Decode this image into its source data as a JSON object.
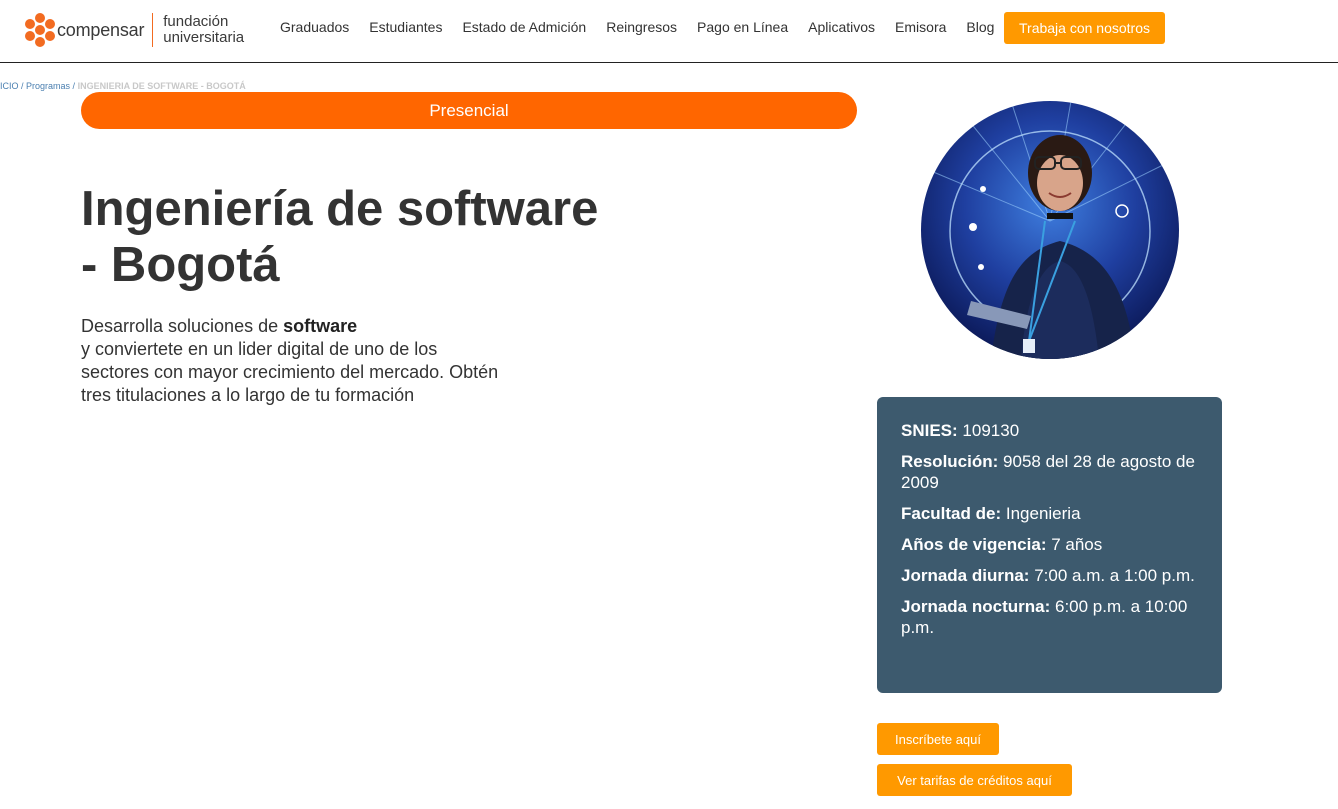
{
  "header": {
    "logo": {
      "brand": "compensar",
      "sub_line1": "fundación",
      "sub_line2": "universitaria"
    },
    "nav": [
      "Graduados",
      "Estudiantes",
      "Estado de Admición",
      "Reingresos",
      "Pago en Línea",
      "Aplicativos",
      "Emisora",
      "Blog"
    ],
    "cta": "Trabaja con nosotros",
    "accent": "#ff9900",
    "brand_color": "#f26b21"
  },
  "breadcrumb": {
    "home": "ICIO",
    "sep1": " / ",
    "programs": "Programas",
    "sep2": " / ",
    "current": "INGENIERIA DE SOFTWARE - BOGOTÁ"
  },
  "mode": "Presencial",
  "title": "Ingeniería de software - Bogotá",
  "intro": {
    "lead": "Desarrolla soluciones de ",
    "bold": "software",
    "rest": "y conviertete en un lider digital de uno de los sectores con mayor crecimiento del mercado. Obtén tres titulaciones a lo largo de tu formación"
  },
  "info": [
    {
      "label": "SNIES:",
      "value": "109130"
    },
    {
      "label": "Resolución:",
      "value": "9058 del 28 de agosto de 2009"
    },
    {
      "label": "Facultad de:",
      "value": "Ingenieria"
    },
    {
      "label": "Años de vigencia:",
      "value": "7 años"
    },
    {
      "label": "Jornada diurna:",
      "value": "7:00 a.m. a 1:00 p.m."
    },
    {
      "label": "Jornada nocturna:",
      "value": "6:00 p.m. a 10:00 p.m."
    }
  ],
  "buttons": {
    "enroll": "Inscríbete aquí",
    "rates": "Ver tarifas de créditos aquí"
  },
  "colors": {
    "pill": "#ff6600",
    "card": "#3d5a6e",
    "button": "#ff9900"
  }
}
